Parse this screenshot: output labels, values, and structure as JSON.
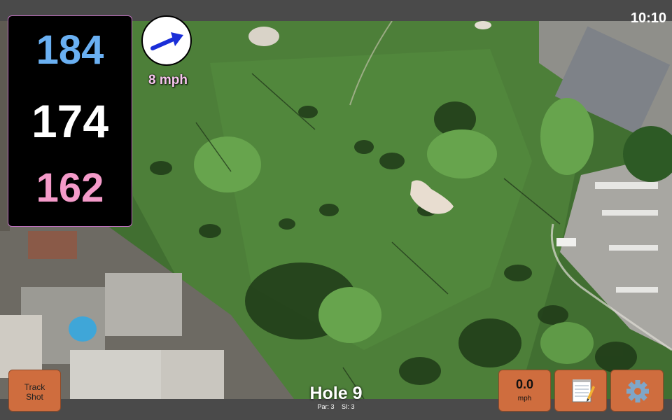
{
  "status": {
    "time": "10:10"
  },
  "distances": {
    "back": "184",
    "middle": "174",
    "front": "162"
  },
  "wind": {
    "speed_label": "8 mph",
    "direction_icon": "arrow-icon"
  },
  "hole": {
    "title": "Hole 9",
    "par_label": "Par: 3",
    "si_label": "SI: 3"
  },
  "buttons": {
    "track_shot_line1": "Track",
    "track_shot_line2": "Shot",
    "speed_value": "0.0",
    "speed_unit": "mph",
    "notes_icon": "notepad-icon",
    "settings_icon": "gear-icon"
  },
  "colors": {
    "back_distance": "#6ab0f2",
    "middle_distance": "#ffffff",
    "front_distance": "#f49ac9",
    "wind_speed": "#f7c6ee",
    "button": "#cf6d3e"
  }
}
